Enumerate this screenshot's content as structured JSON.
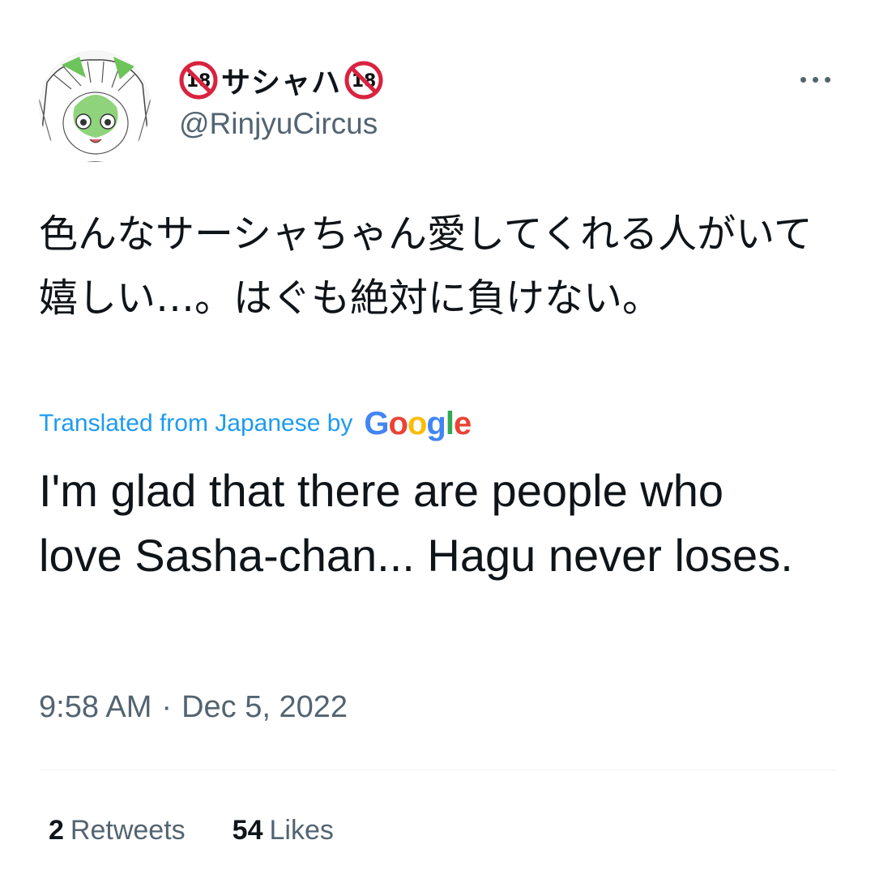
{
  "author": {
    "display_name": "サシャハ",
    "handle": "@RinjyuCircus",
    "badge_icon": "no-under-18-icon",
    "badge_text": "18"
  },
  "tweet": {
    "original_text": "色んなサーシャちゃん愛してくれる人がいて嬉しい…。はぐも絶対に負けない。",
    "translated_label": "Translated from Japanese by",
    "translator": "Google",
    "translation": "I'm glad that there are people who love Sasha-chan... Hagu never loses.",
    "time": "9:58 AM",
    "separator": "·",
    "date": "Dec 5, 2022"
  },
  "stats": {
    "retweets_count": "2",
    "retweets_label": "Retweets",
    "likes_count": "54",
    "likes_label": "Likes"
  },
  "colors": {
    "primary_text": "#0f1419",
    "secondary_text": "#536471",
    "link": "#1d9bf0",
    "badge_red": "#d9223f",
    "google": [
      "#4285F4",
      "#EA4335",
      "#FBBC05",
      "#4285F4",
      "#34A853",
      "#EA4335"
    ]
  },
  "icons": {
    "more": "more-horizontal-icon",
    "avatar": "profile-avatar"
  }
}
